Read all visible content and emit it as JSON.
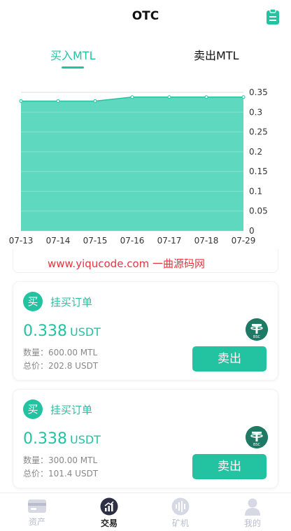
{
  "header": {
    "title": "OTC",
    "icon": "clipboard-icon"
  },
  "tabs": [
    {
      "label": "买入MTL",
      "active": true
    },
    {
      "label": "卖出MTL",
      "active": false
    }
  ],
  "chart_data": {
    "type": "area",
    "x": [
      "07-13",
      "07-14",
      "07-15",
      "07-16",
      "07-17",
      "07-18",
      "07-29"
    ],
    "values": [
      0.328,
      0.328,
      0.328,
      0.338,
      0.338,
      0.338,
      0.338
    ],
    "ylim": [
      0,
      0.35
    ],
    "yticks": [
      "0.35",
      "0.3",
      "0.25",
      "0.2",
      "0.15",
      "0.1",
      "0.05",
      "0"
    ],
    "color": "#5fd8c0",
    "line_color": "#23c3a2",
    "grid": true
  },
  "watermark": "www.yiqucode.com  一曲源码网",
  "orders": [
    {
      "badge": "买",
      "type": "挂买订单",
      "price": "0.338",
      "unit": "USDT",
      "coin_icon": "usdt-bsc-icon",
      "quantity": "数量：600.00 MTL",
      "total": "总价：202.8 USDT",
      "action": "卖出"
    },
    {
      "badge": "买",
      "type": "挂买订单",
      "price": "0.338",
      "unit": "USDT",
      "coin_icon": "usdt-bsc-icon",
      "quantity": "数量：300.00 MTL",
      "total": "总价：101.4 USDT",
      "action": "卖出"
    }
  ],
  "tabbar": [
    {
      "label": "资产",
      "icon": "wallet-icon",
      "active": false
    },
    {
      "label": "交易",
      "icon": "trade-icon",
      "active": true
    },
    {
      "label": "矿机",
      "icon": "miner-icon",
      "active": false
    },
    {
      "label": "我的",
      "icon": "user-icon",
      "active": false
    }
  ],
  "colors": {
    "accent": "#23c3a2",
    "inactive": "#b8bccc",
    "watermark": "#e5343e"
  }
}
